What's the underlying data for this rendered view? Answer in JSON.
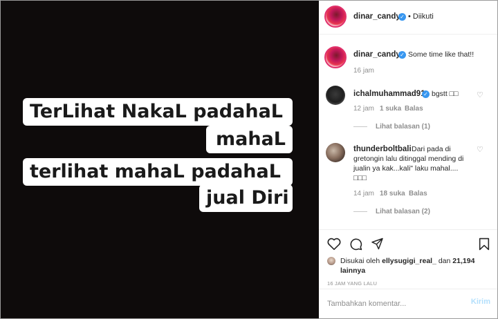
{
  "post": {
    "caption_lines": [
      "TerLihat NakaL  padahaL",
      "mahaL",
      "terlihat mahaL padahaL",
      "jual Diri"
    ]
  },
  "header": {
    "username": "dinar_candy",
    "follow_status": "• Diikuti"
  },
  "caption": {
    "username": "dinar_candy",
    "text": "Some time like that!!",
    "time": "16 jam"
  },
  "comments": [
    {
      "username": "ichalmuhammad91",
      "text": "bgstt □□",
      "time": "12 jam",
      "likes": "1 suka",
      "reply": "Balas",
      "view_replies": "Lihat balasan (1)"
    },
    {
      "username": "thunderboltbali",
      "text": "Dari pada di gretongin lalu ditinggal mending di jualin ya kak...kali\" laku mahal.... □□□",
      "time": "14 jam",
      "likes": "18 suka",
      "reply": "Balas",
      "view_replies": "Lihat balasan (2)"
    }
  ],
  "actions": {
    "liked_by_prefix": "Disukai oleh",
    "liked_by_user": "ellysugigi_real_",
    "liked_by_conj": "dan",
    "others": "21,194 lainnya",
    "timestamp": "16 JAM YANG LALU"
  },
  "comment_box": {
    "placeholder": "Tambahkan komentar...",
    "send_label": "Kirim"
  },
  "colors": {
    "verified": "#3897f0",
    "send_disabled": "#b2dffc",
    "muted": "#8e8e8e"
  }
}
